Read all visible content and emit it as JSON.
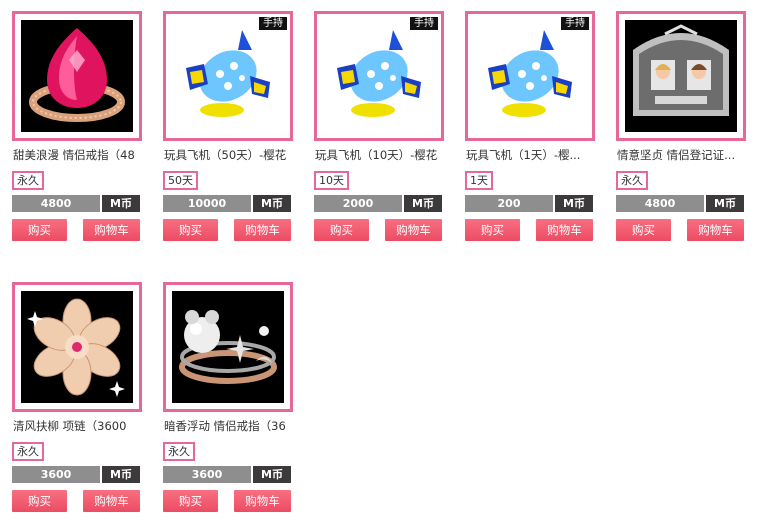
{
  "products": [
    {
      "name": "甜美浪漫 情侣戒指（48",
      "duration": "永久",
      "price": "4800",
      "currency": "M币",
      "buy_label": "购买",
      "cart_label": "购物车",
      "badge": "",
      "image_icon": "pink-gem-ring-icon"
    },
    {
      "name": "玩具飞机（50天）-樱花",
      "duration": "50天",
      "price": "10000",
      "currency": "M币",
      "buy_label": "购买",
      "cart_label": "购物车",
      "badge": "手持",
      "image_icon": "toy-plane-icon"
    },
    {
      "name": "玩具飞机（10天）-樱花",
      "duration": "10天",
      "price": "2000",
      "currency": "M币",
      "buy_label": "购买",
      "cart_label": "购物车",
      "badge": "手持",
      "image_icon": "toy-plane-icon"
    },
    {
      "name": "玩具飞机（1天）-樱...",
      "duration": "1天",
      "price": "200",
      "currency": "M币",
      "buy_label": "购买",
      "cart_label": "购物车",
      "badge": "手持",
      "image_icon": "toy-plane-icon"
    },
    {
      "name": "情意坚贞 情侣登记证...",
      "duration": "永久",
      "price": "4800",
      "currency": "M币",
      "buy_label": "购买",
      "cart_label": "购物车",
      "badge": "",
      "image_icon": "couple-certificate-icon"
    },
    {
      "name": "清风扶柳 项链（3600",
      "duration": "永久",
      "price": "3600",
      "currency": "M币",
      "buy_label": "购买",
      "cart_label": "购物车",
      "badge": "",
      "image_icon": "flower-necklace-icon"
    },
    {
      "name": "暗香浮动 情侣戒指（36",
      "duration": "永久",
      "price": "3600",
      "currency": "M币",
      "buy_label": "购买",
      "cart_label": "购物车",
      "badge": "",
      "image_icon": "pearl-ring-icon"
    }
  ],
  "colors": {
    "border": "#e8679a",
    "button": "#f25d73",
    "price_bg": "#8e8e8e",
    "coin_bg": "#3d3a3b"
  }
}
